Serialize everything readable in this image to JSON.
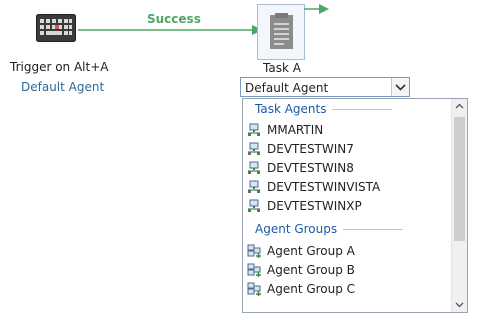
{
  "trigger": {
    "label": "Trigger on Alt+A",
    "agent": "Default Agent",
    "icon": "keyboard-icon"
  },
  "connector": {
    "label": "Success",
    "color": "#4aa867"
  },
  "task": {
    "label": "Task A",
    "icon": "document-icon"
  },
  "agent_select": {
    "value": "Default Agent"
  },
  "dropdown": {
    "task_agents_header": "Task Agents",
    "agents": [
      {
        "label": "MMARTIN",
        "icon": "network-computer-icon"
      },
      {
        "label": "DEVTESTWIN7",
        "icon": "network-computer-icon"
      },
      {
        "label": "DEVTESTWIN8",
        "icon": "network-computer-icon"
      },
      {
        "label": "DEVTESTWINVISTA",
        "icon": "network-computer-icon"
      },
      {
        "label": "DEVTESTWINXP",
        "icon": "network-computer-icon"
      }
    ],
    "agent_groups_header": "Agent Groups",
    "groups": [
      {
        "label": "Agent Group A",
        "icon": "agent-group-icon"
      },
      {
        "label": "Agent Group B",
        "icon": "agent-group-icon"
      },
      {
        "label": "Agent Group C",
        "icon": "agent-group-icon"
      }
    ]
  }
}
